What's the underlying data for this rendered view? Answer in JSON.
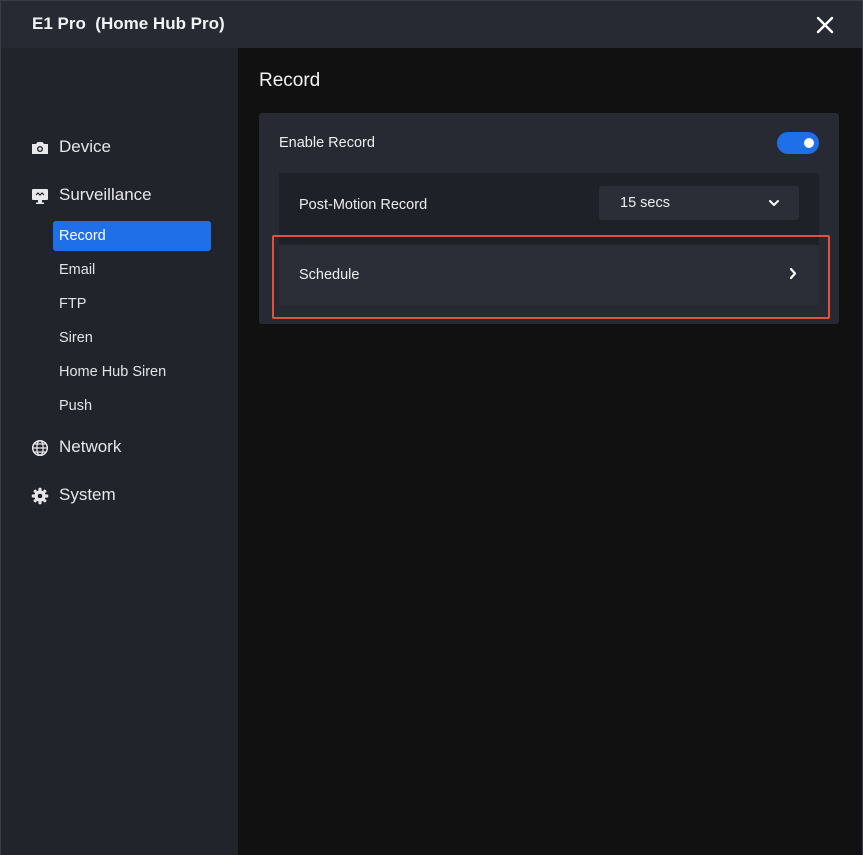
{
  "window": {
    "title": "E1 Pro  (Home Hub Pro)"
  },
  "sidebar": {
    "groups": [
      {
        "label": "Device",
        "icon": "camera-icon"
      },
      {
        "label": "Surveillance",
        "icon": "monitor-icon"
      },
      {
        "label": "Network",
        "icon": "globe-icon"
      },
      {
        "label": "System",
        "icon": "gear-icon"
      }
    ],
    "surveillance_items": [
      {
        "label": "Record",
        "active": true
      },
      {
        "label": "Email"
      },
      {
        "label": "FTP"
      },
      {
        "label": "Siren"
      },
      {
        "label": "Home Hub Siren"
      },
      {
        "label": "Push"
      }
    ]
  },
  "main": {
    "title": "Record",
    "enable_record": {
      "label": "Enable Record",
      "on": true
    },
    "post_motion": {
      "label": "Post-Motion Record",
      "value": "15 secs"
    },
    "schedule": {
      "label": "Schedule"
    }
  },
  "colors": {
    "accent": "#1f6fe8",
    "highlight": "#e2513f"
  }
}
